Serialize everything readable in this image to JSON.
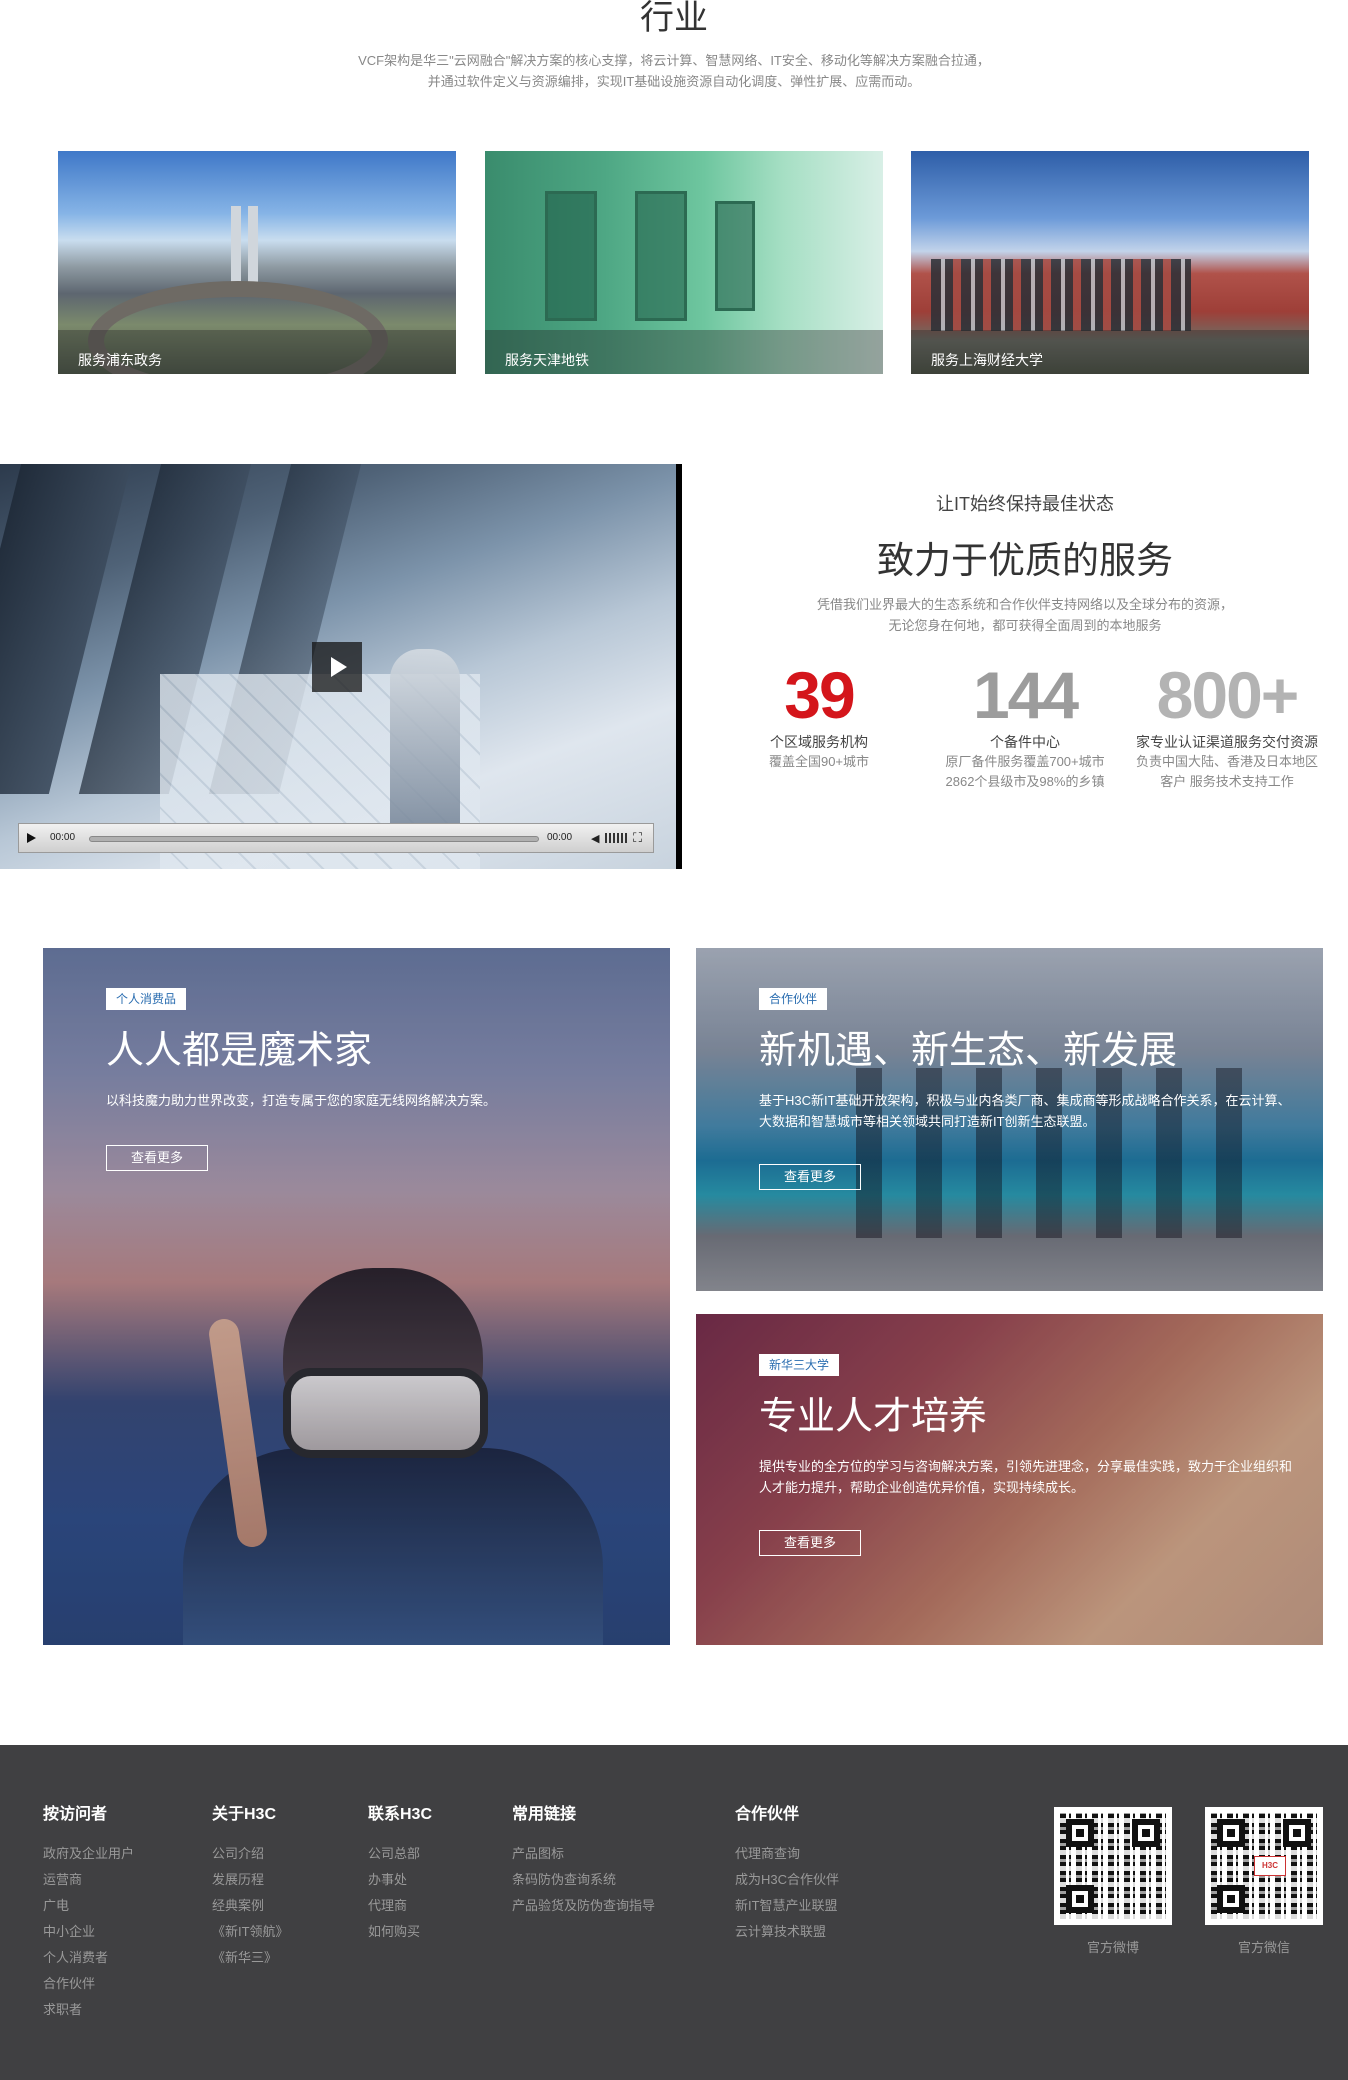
{
  "industry": {
    "title": "行业",
    "desc_line1": "VCF架构是华三\"云网融合\"解决方案的核心支撑，将云计算、智慧网络、IT安全、移动化等解决方案融合拉通，",
    "desc_line2": "并通过软件定义与资源编排，实现IT基础设施资源自动化调度、弹性扩展、应需而动。",
    "cards": [
      {
        "caption": "服务浦东政务"
      },
      {
        "caption": "服务天津地铁"
      },
      {
        "caption": "服务上海财经大学"
      }
    ]
  },
  "video": {
    "current_time": "00:00",
    "duration": "00:00",
    "icons": {
      "play": "play-icon",
      "volume": "volume-icon",
      "fullscreen": "fullscreen-icon"
    }
  },
  "service": {
    "subtitle": "让IT始终保持最佳状态",
    "title": "致力于优质的服务",
    "desc_line1": "凭借我们业界最大的生态系统和合作伙伴支持网络以及全球分布的资源，",
    "desc_line2": "无论您身在何地，都可获得全面周到的本地服务",
    "stats": [
      {
        "number": "39",
        "label": "个区域服务机构",
        "note1": "覆盖全国90+城市",
        "note2": ""
      },
      {
        "number": "144",
        "label": "个备件中心",
        "note1": "原厂备件服务覆盖700+城市",
        "note2": "2862个县级市及98%的乡镇"
      },
      {
        "number": "800+",
        "label": "家专业认证渠道服务交付资源",
        "note1": "负责中国大陆、香港及日本地区",
        "note2": "客户 服务技术支持工作"
      }
    ]
  },
  "tiles": [
    {
      "tag": "个人消费品",
      "heading": "人人都是魔术家",
      "body": "以科技魔力助力世界改变，打造专属于您的家庭无线网络解决方案。",
      "more": "查看更多"
    },
    {
      "tag": "合作伙伴",
      "heading": "新机遇、新生态、新发展",
      "body": "基于H3C新IT基础开放架构，积极与业内各类厂商、集成商等形成战略合作关系，在云计算、大数据和智慧城市等相关领域共同打造新IT创新生态联盟。",
      "more": "查看更多"
    },
    {
      "tag": "新华三大学",
      "heading": "专业人才培养",
      "body": "提供专业的全方位的学习与咨询解决方案，引领先进理念，分享最佳实践，致力于企业组织和人才能力提升，帮助企业创造优异价值，实现持续成长。",
      "more": "查看更多"
    }
  ],
  "footer": {
    "columns": [
      {
        "title": "按访问者",
        "links": [
          "政府及企业用户",
          "运营商",
          "广电",
          "中小企业",
          "个人消费者",
          "合作伙伴",
          "求职者"
        ]
      },
      {
        "title": "关于H3C",
        "links": [
          "公司介绍",
          "发展历程",
          "经典案例",
          "《新IT领航》",
          "《新华三》"
        ]
      },
      {
        "title": "联系H3C",
        "links": [
          "公司总部",
          "办事处",
          "代理商",
          "如何购买"
        ]
      },
      {
        "title": "常用链接",
        "links": [
          "产品图标",
          "条码防伪查询系统",
          "产品验货及防伪查询指导"
        ]
      },
      {
        "title": "合作伙伴",
        "links": [
          "代理商查询",
          "成为H3C合作伙伴",
          "新IT智慧产业联盟",
          "云计算技术联盟"
        ]
      }
    ],
    "qr": [
      {
        "caption": "官方微博"
      },
      {
        "caption": "官方微信",
        "logo": "H3C"
      }
    ]
  }
}
